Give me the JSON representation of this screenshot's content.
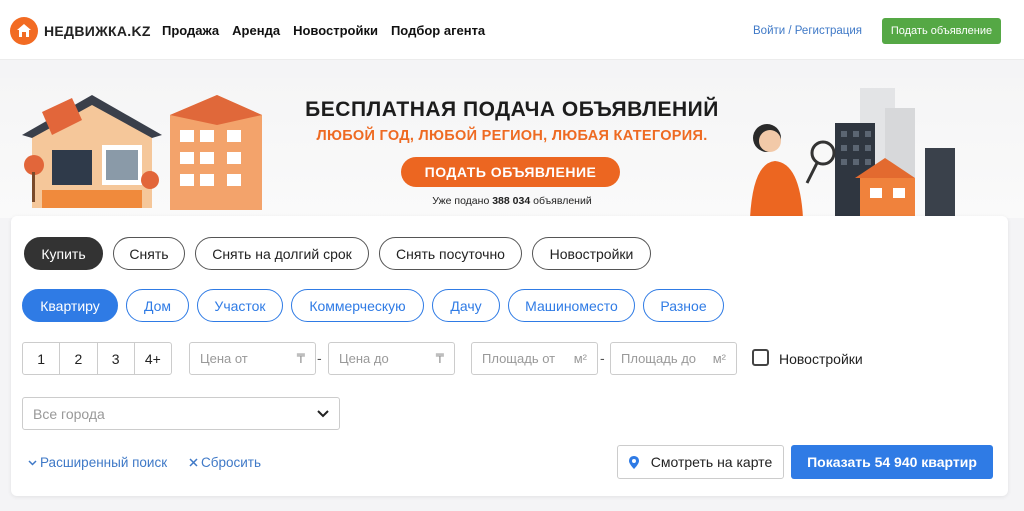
{
  "header": {
    "logo_text": "НЕДВИЖКА.KZ",
    "nav": [
      "Продажа",
      "Аренда",
      "Новостройки",
      "Подбор агента"
    ],
    "login_label": "Войти / Регистрация",
    "post_button_label": "Подать объявление"
  },
  "banner": {
    "title": "БЕСПЛАТНАЯ ПОДАЧА ОБЪЯВЛЕНИЙ",
    "subtitle": "ЛЮБОЙ ГОД, ЛЮБОЙ РЕГИОН, ЛЮБАЯ КАТЕГОРИЯ.",
    "cta_label": "ПОДАТЬ ОБЪЯВЛЕНИЕ",
    "count_prefix": "Уже подано",
    "count_value": "388 034",
    "count_suffix": "объявлений"
  },
  "search": {
    "deal_types": [
      "Купить",
      "Снять",
      "Снять на долгий срок",
      "Снять посуточно",
      "Новостройки"
    ],
    "property_types": [
      "Квартиру",
      "Дом",
      "Участок",
      "Коммерческую",
      "Дачу",
      "Машиноместо",
      "Разное"
    ],
    "rooms": [
      "1",
      "2",
      "3",
      "4+"
    ],
    "price_from_placeholder": "Цена от",
    "price_to_placeholder": "Цена до",
    "currency_symbol": "₸",
    "area_from_placeholder": "Площадь от",
    "area_to_placeholder": "Площадь до",
    "area_unit": "м²",
    "dash": "-",
    "new_buildings_label": "Новостройки",
    "city_placeholder": "Все города",
    "advanced_label": "Расширенный поиск",
    "reset_label": "Сбросить",
    "map_button_label": "Смотреть на карте",
    "show_button_label": "Показать 54 940 квартир"
  },
  "colors": {
    "brand_orange": "#ec6621",
    "accent_blue": "#2f7be5",
    "green": "#55a845"
  }
}
